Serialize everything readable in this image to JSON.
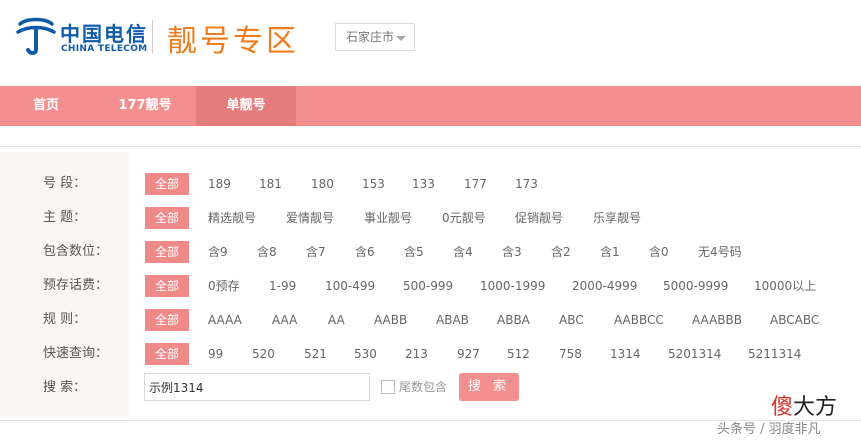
{
  "header": {
    "logo_cn": "中国电信",
    "logo_en": "CHINA TELECOM",
    "zone_title": "靓号专区",
    "city": "石家庄市"
  },
  "nav": {
    "items": [
      {
        "label": "首页"
      },
      {
        "label": "177靓号"
      },
      {
        "label": "单靓号"
      }
    ],
    "active_index": 2
  },
  "filters": {
    "rows": [
      {
        "label": "号    段：",
        "options": [
          "全部",
          "189",
          "181",
          "180",
          "153",
          "133",
          "177",
          "173"
        ]
      },
      {
        "label": "主    题：",
        "options": [
          "全部",
          "精选靓号",
          "爱情靓号",
          "事业靓号",
          "0元靓号",
          "促销靓号",
          "乐享靓号"
        ]
      },
      {
        "label": "包含数位：",
        "options": [
          "全部",
          "含9",
          "含8",
          "含7",
          "含6",
          "含5",
          "含4",
          "含3",
          "含2",
          "含1",
          "含0",
          "无4号码"
        ]
      },
      {
        "label": "预存话费：",
        "options": [
          "全部",
          "0预存",
          "1-99",
          "100-499",
          "500-999",
          "1000-1999",
          "2000-4999",
          "5000-9999",
          "10000以上"
        ]
      },
      {
        "label": "规    则：",
        "options": [
          "全部",
          "AAAA",
          "AAA",
          "AA",
          "AABB",
          "ABAB",
          "ABBA",
          "ABC",
          "AABBCC",
          "AAABBB",
          "ABCABC"
        ]
      },
      {
        "label": "快速查询：",
        "options": [
          "全部",
          "99",
          "520",
          "521",
          "530",
          "213",
          "927",
          "512",
          "758",
          "1314",
          "5201314",
          "5211314"
        ]
      }
    ],
    "selected_index": 0
  },
  "search": {
    "label": "搜    索：",
    "value": "示例1314",
    "checkbox_label": "尾数包含",
    "checkbox_checked": false,
    "button_label": "搜 索"
  },
  "watermark": {
    "brand_first": "傻",
    "brand_rest": "大方",
    "author": "头条号 / 羽度非凡"
  },
  "colors": {
    "brand_blue": "#0f5ba8",
    "zone_orange": "#ef7d1e",
    "nav_pink": "#f38f8e",
    "selected_pink": "#f08a89"
  }
}
